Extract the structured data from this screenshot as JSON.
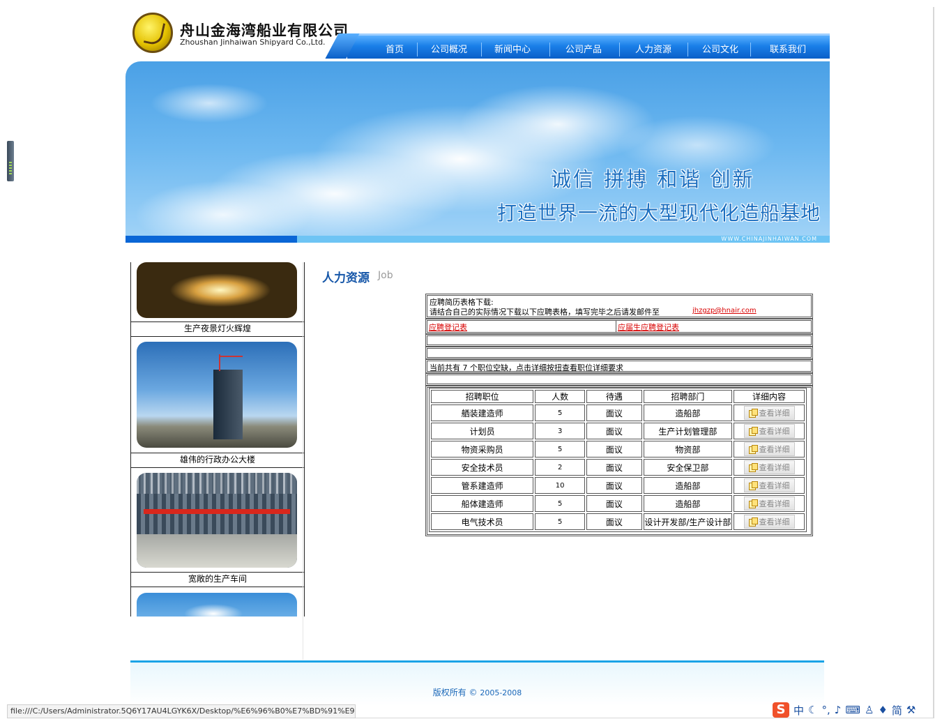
{
  "header": {
    "company_cn": "舟山金海湾船业有限公司",
    "company_en": "Zhoushan Jinhaiwan Shipyard Co.,Ltd."
  },
  "nav": {
    "items": [
      "首页",
      "公司概况",
      "新闻中心",
      "公司产品",
      "人力资源",
      "公司文化",
      "联系我们"
    ]
  },
  "banner": {
    "slogan1": "诚信  拼搏  和谐  创新",
    "slogan2": "打造世界一流的大型现代化造船基地",
    "url": "WWW.CHINAJINHAIWAN.COM"
  },
  "sidebar": {
    "captions": [
      "生产夜景灯火辉煌",
      "雄伟的行政办公大楼",
      "宽敞的生产车间"
    ]
  },
  "section": {
    "title": "人力资源",
    "subtitle": "Job"
  },
  "download": {
    "heading": "应聘简历表格下载:",
    "instruction": "请结合自己的实际情况下载以下应聘表格，填写完毕之后请发邮件至",
    "email": "jhzgzp@hnair.com",
    "form1": "应聘登记表",
    "form2": "应届生应聘登记表"
  },
  "summary": {
    "text": "当前共有 7 个职位空缺，点击详细按扭查看职位详细要求"
  },
  "jobs": {
    "headers": [
      "招聘职位",
      "人数",
      "待遇",
      "招聘部门",
      "详细内容"
    ],
    "detail_label": "查看详细",
    "rows": [
      {
        "title": "舾装建造师",
        "count": "5",
        "pay": "面议",
        "dept": "造船部"
      },
      {
        "title": "计划员",
        "count": "3",
        "pay": "面议",
        "dept": "生产计划管理部"
      },
      {
        "title": "物资采购员",
        "count": "5",
        "pay": "面议",
        "dept": "物资部"
      },
      {
        "title": "安全技术员",
        "count": "2",
        "pay": "面议",
        "dept": "安全保卫部"
      },
      {
        "title": "管系建造师",
        "count": "10",
        "pay": "面议",
        "dept": "造船部"
      },
      {
        "title": "船体建造师",
        "count": "5",
        "pay": "面议",
        "dept": "造船部"
      },
      {
        "title": "电气技术员",
        "count": "5",
        "pay": "面议",
        "dept": "设计开发部/生产设计部"
      }
    ]
  },
  "footer": {
    "copyright": "版权所有 © ",
    "years": "2005-2008"
  },
  "status_bar": {
    "url": "file:///C:/Users/Administrator.5Q6Y17AU4LGYK6X/Desktop/%E6%96%B0%E7%BD%91%E9%"
  },
  "ime": {
    "mode": "中",
    "charset": "简"
  },
  "colors": {
    "nav_blue": "#1a7fe8",
    "title_blue": "#1556a8",
    "link_red": "#d80000",
    "footer_line": "#1aa3e6"
  }
}
